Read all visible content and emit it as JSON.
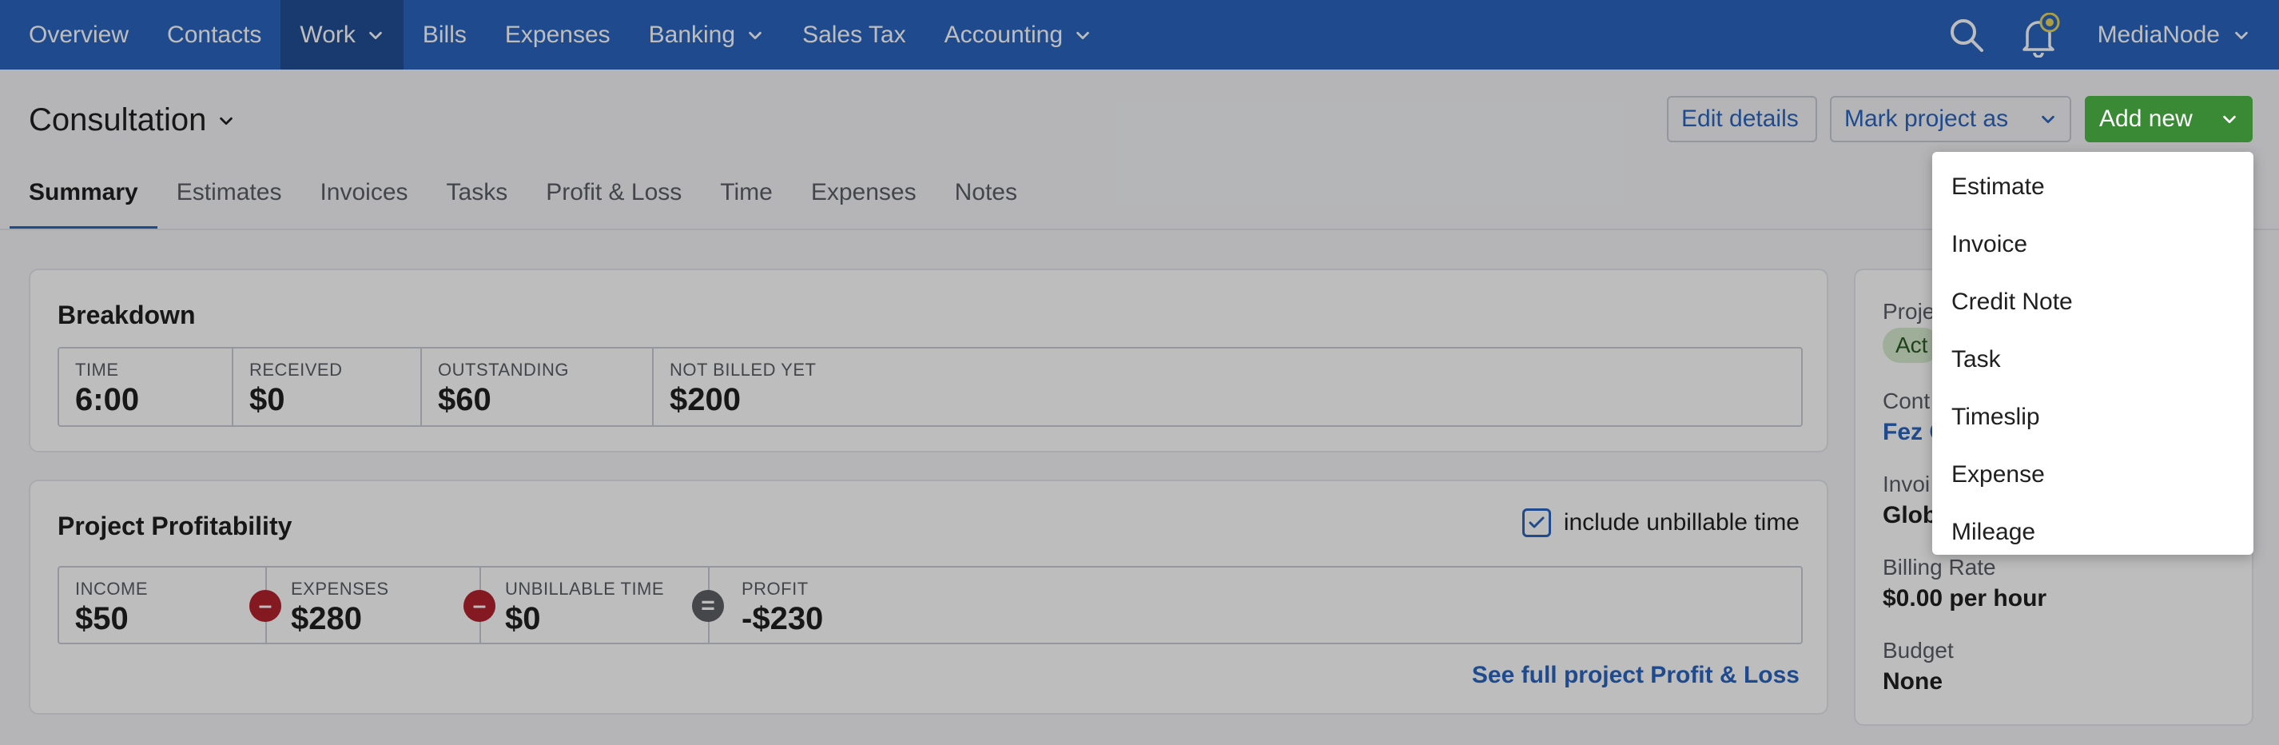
{
  "nav": {
    "items": [
      {
        "label": "Overview",
        "dropdown": false,
        "active": false
      },
      {
        "label": "Contacts",
        "dropdown": false,
        "active": false
      },
      {
        "label": "Work",
        "dropdown": true,
        "active": true
      },
      {
        "label": "Bills",
        "dropdown": false,
        "active": false
      },
      {
        "label": "Expenses",
        "dropdown": false,
        "active": false
      },
      {
        "label": "Banking",
        "dropdown": true,
        "active": false
      },
      {
        "label": "Sales Tax",
        "dropdown": false,
        "active": false
      },
      {
        "label": "Accounting",
        "dropdown": true,
        "active": false
      }
    ],
    "user": "MediaNode",
    "icons": {
      "search": "search-icon",
      "notifications": "bell-icon"
    }
  },
  "header": {
    "title": "Consultation",
    "edit_details": "Edit details",
    "mark_project": "Mark project as",
    "add_new": "Add new"
  },
  "tabs": [
    "Summary",
    "Estimates",
    "Invoices",
    "Tasks",
    "Profit & Loss",
    "Time",
    "Expenses",
    "Notes"
  ],
  "breakdown": {
    "title": "Breakdown",
    "stats": [
      {
        "label": "TIME",
        "value": "6:00"
      },
      {
        "label": "RECEIVED",
        "value": "$0"
      },
      {
        "label": "OUTSTANDING",
        "value": "$60"
      },
      {
        "label": "NOT BILLED YET",
        "value": "$200"
      }
    ]
  },
  "profitability": {
    "title": "Project Profitability",
    "include_unbillable": "include unbillable time",
    "include_unbillable_checked": true,
    "stats": [
      {
        "label": "INCOME",
        "value": "$50"
      },
      {
        "label": "EXPENSES",
        "value": "$280"
      },
      {
        "label": "UNBILLABLE TIME",
        "value": "$0"
      },
      {
        "label": "PROFIT",
        "value": "-$230"
      }
    ],
    "link": "See full project Profit & Loss"
  },
  "sidebar": {
    "status_label": "Proje",
    "status_value": "Act",
    "contact_label": "Cont",
    "contact_value": "Fez C",
    "invoice_label": "Invoi",
    "invoice_value": "Glob",
    "billing_rate_label": "Billing Rate",
    "billing_rate_value": "$0.00 per hour",
    "budget_label": "Budget",
    "budget_value": "None"
  },
  "add_new_menu": {
    "items": [
      "Estimate",
      "Invoice",
      "Credit Note",
      "Task",
      "Timeslip",
      "Expense",
      "Mileage"
    ],
    "highlighted": "Invoice"
  },
  "colors": {
    "nav_bg": "#2b66c0",
    "nav_active": "#234f96",
    "accent": "#2b66c0",
    "add_btn": "#3a8a35",
    "minus_op": "#b3232e",
    "equals_op": "#5e6166"
  }
}
